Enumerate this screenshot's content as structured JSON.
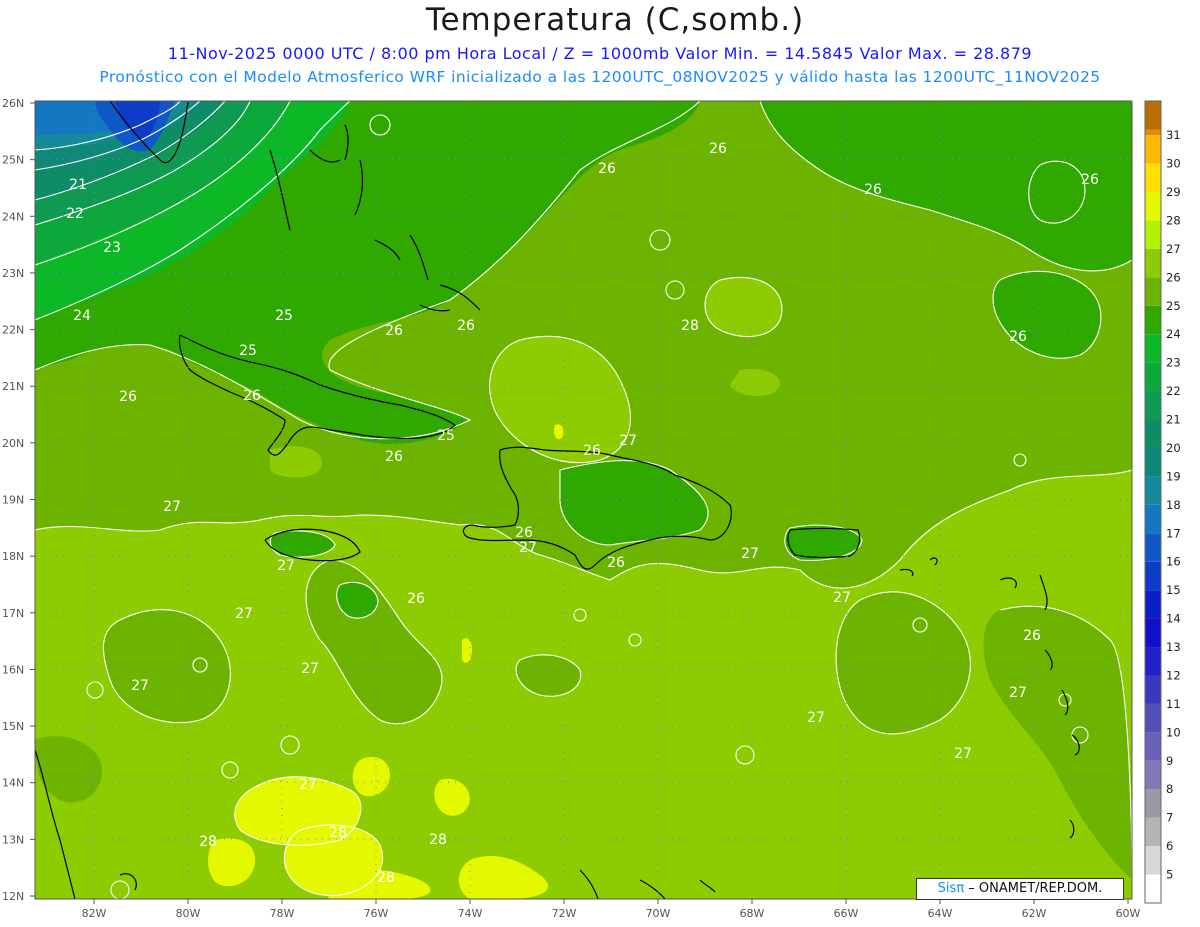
{
  "title": "Temperatura (C,somb.)",
  "subtitle_line1": "11-Nov-2025  0000 UTC / 8:00 pm Hora Local / Z = 1000mb    Valor Min. = 14.5845  Valor Max. = 28.879",
  "subtitle_line2": "Pronóstico con el Modelo Atmosferico WRF inicializado a las 1200UTC_08NOV2025 y válido hasta las  1200UTC_11NOV2025",
  "credit": {
    "sis": "Sis",
    "pi": "π",
    "rest": "– ONAMET/REP.DOM."
  },
  "lat_labels": [
    "26N",
    "25N",
    "24N",
    "23N",
    "22N",
    "21N",
    "20N",
    "19N",
    "18N",
    "17N",
    "16N",
    "15N",
    "14N",
    "13N",
    "12N"
  ],
  "lon_labels": [
    "82W",
    "80W",
    "78W",
    "76W",
    "74W",
    "72W",
    "70W",
    "68W",
    "66W",
    "64W",
    "62W",
    "60W"
  ],
  "colorbar": {
    "values": [
      "5",
      "6",
      "7",
      "8",
      "9",
      "10",
      "11",
      "12",
      "13",
      "14",
      "15",
      "16",
      "17",
      "18",
      "19",
      "20",
      "21",
      "22",
      "23",
      "24",
      "25",
      "26",
      "27",
      "28",
      "29",
      "30",
      "31"
    ],
    "colors": [
      "#ffffff",
      "#d8d8d8",
      "#b4b4b4",
      "#9a9aa6",
      "#8478b4",
      "#6a62b8",
      "#5050b8",
      "#3838c0",
      "#2020c8",
      "#1010c8",
      "#0a1ec8",
      "#0c3cc8",
      "#1058c8",
      "#1478c0",
      "#148a9a",
      "#108878",
      "#0e8c66",
      "#0e9a50",
      "#0ca83c",
      "#0cb826",
      "#2fa800",
      "#6cb400",
      "#8ccc00",
      "#b4f000",
      "#e4f800",
      "#ffe000",
      "#ffb800",
      "#e08c00",
      "#b86e00"
    ]
  },
  "contour_labels": [
    {
      "text": "21"
    },
    {
      "text": "22"
    },
    {
      "text": "23"
    },
    {
      "text": "24"
    },
    {
      "text": "25"
    },
    {
      "text": "25"
    },
    {
      "text": "26"
    },
    {
      "text": "26"
    },
    {
      "text": "26"
    },
    {
      "text": "26"
    },
    {
      "text": "26"
    },
    {
      "text": "26"
    },
    {
      "text": "26"
    },
    {
      "text": "26"
    },
    {
      "text": "25"
    },
    {
      "text": "26"
    },
    {
      "text": "27"
    },
    {
      "text": "26"
    },
    {
      "text": "27"
    },
    {
      "text": "27"
    },
    {
      "text": "27"
    },
    {
      "text": "26"
    },
    {
      "text": "27"
    },
    {
      "text": "27"
    },
    {
      "text": "27"
    },
    {
      "text": "26"
    },
    {
      "text": "27"
    },
    {
      "text": "27"
    },
    {
      "text": "27"
    },
    {
      "text": "26"
    },
    {
      "text": "26"
    },
    {
      "text": "27"
    },
    {
      "text": "27"
    },
    {
      "text": "27"
    },
    {
      "text": "28"
    },
    {
      "text": "28"
    },
    {
      "text": "28"
    },
    {
      "text": "28"
    },
    {
      "text": "28"
    },
    {
      "text": "26"
    }
  ]
}
